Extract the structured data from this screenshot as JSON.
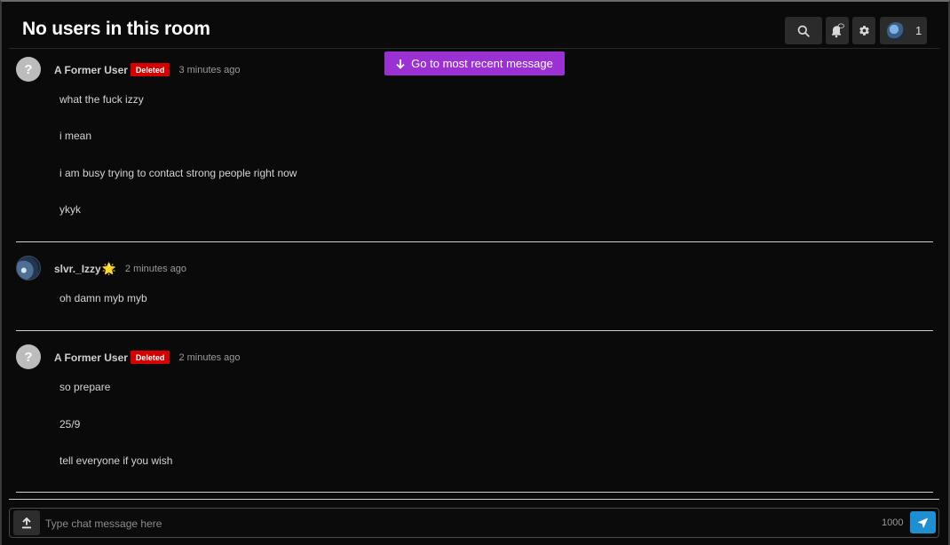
{
  "header": {
    "title": "No users in this room",
    "user_count": "1"
  },
  "jump_button": {
    "label": "Go to most recent message"
  },
  "messages": [
    {
      "username": "A Former User",
      "badge": "Deleted",
      "avatar_glyph": "?",
      "time": "3 minutes ago",
      "lines": [
        "what the fuck izzy",
        "i mean",
        "i am busy trying to contact strong people right now",
        "ykyk"
      ]
    },
    {
      "username": "slvr._Izzy",
      "badge": "",
      "avatar_glyph": "",
      "decoration": "🌟",
      "time": "2 minutes ago",
      "lines": [
        "oh damn myb myb"
      ]
    },
    {
      "username": "A Former User",
      "badge": "Deleted",
      "avatar_glyph": "?",
      "time": "2 minutes ago",
      "lines": [
        "so prepare",
        "25/9",
        "tell everyone if you wish"
      ]
    }
  ],
  "composer": {
    "placeholder": "Type chat message here",
    "value": "",
    "char_limit": "1000"
  },
  "icons": {
    "search": "search-icon",
    "bell": "bell-icon",
    "gear": "gear-icon",
    "upload": "upload-icon",
    "send": "send-icon",
    "arrow": "arrow-down-icon"
  },
  "colors": {
    "background": "#0a0a0a",
    "jump_button": "#9b31d2",
    "deleted_badge": "#d50000",
    "send_button": "#1f8fd1"
  }
}
